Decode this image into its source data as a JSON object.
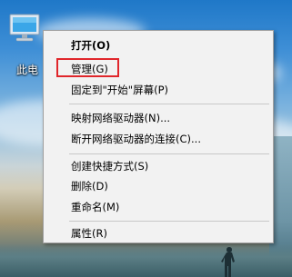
{
  "desktop": {
    "icon": {
      "name": "pc-icon",
      "label": "此电"
    }
  },
  "context_menu": {
    "items": [
      {
        "label": "打开(O)",
        "bold": true
      },
      {
        "label": "管理(G)",
        "highlighted": true
      },
      {
        "label": "固定到\"开始\"屏幕(P)"
      },
      {
        "label": "映射网络驱动器(N)..."
      },
      {
        "label": "断开网络驱动器的连接(C)..."
      },
      {
        "label": "创建快捷方式(S)"
      },
      {
        "label": "删除(D)"
      },
      {
        "label": "重命名(M)"
      },
      {
        "label": "属性(R)"
      }
    ],
    "highlight_color": "#e0262b",
    "background": "#f2f2f2"
  }
}
